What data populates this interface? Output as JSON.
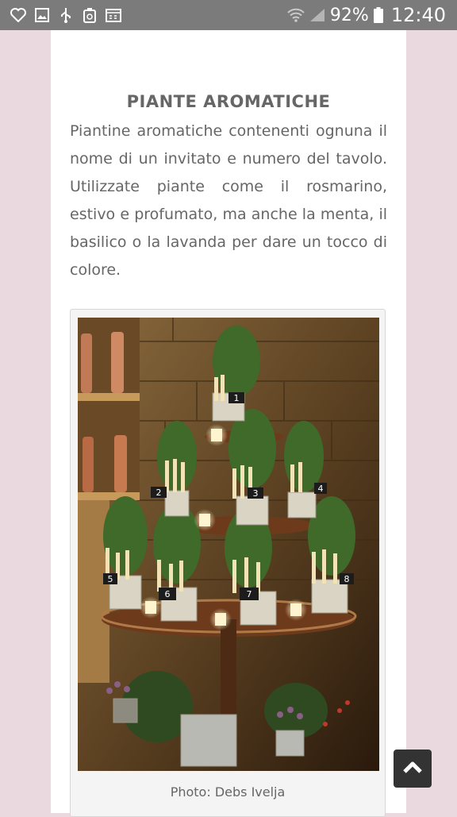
{
  "status_bar": {
    "left_icons": [
      "heart-outline-icon",
      "gallery-icon",
      "usb-icon",
      "recycle-icon",
      "calendar-icon"
    ],
    "right_icons": [
      "wifi-icon",
      "signal-icon",
      "battery-icon"
    ],
    "battery": "92%",
    "time": "12:40"
  },
  "article": {
    "title": "PIANTE AROMATICHE",
    "body": "Piantine aromatiche contenenti ognuna il nome di un invitato e numero del tavolo. Utilizzate piante come il rosmarino, estivo e profumato, ma anche la menta, il basilico o la lavanda per dare un tocco di colore.",
    "photo_caption": "Photo: Debs Ivelja",
    "table_numbers": [
      "1",
      "2",
      "3",
      "4",
      "5",
      "6",
      "7",
      "8"
    ]
  },
  "scroll_top_icon": "chevron-up-icon",
  "colors": {
    "page_background": "#ead9de",
    "status_bar": "#7b7b7b",
    "text": "#666666",
    "scroll_button": "#333333"
  }
}
